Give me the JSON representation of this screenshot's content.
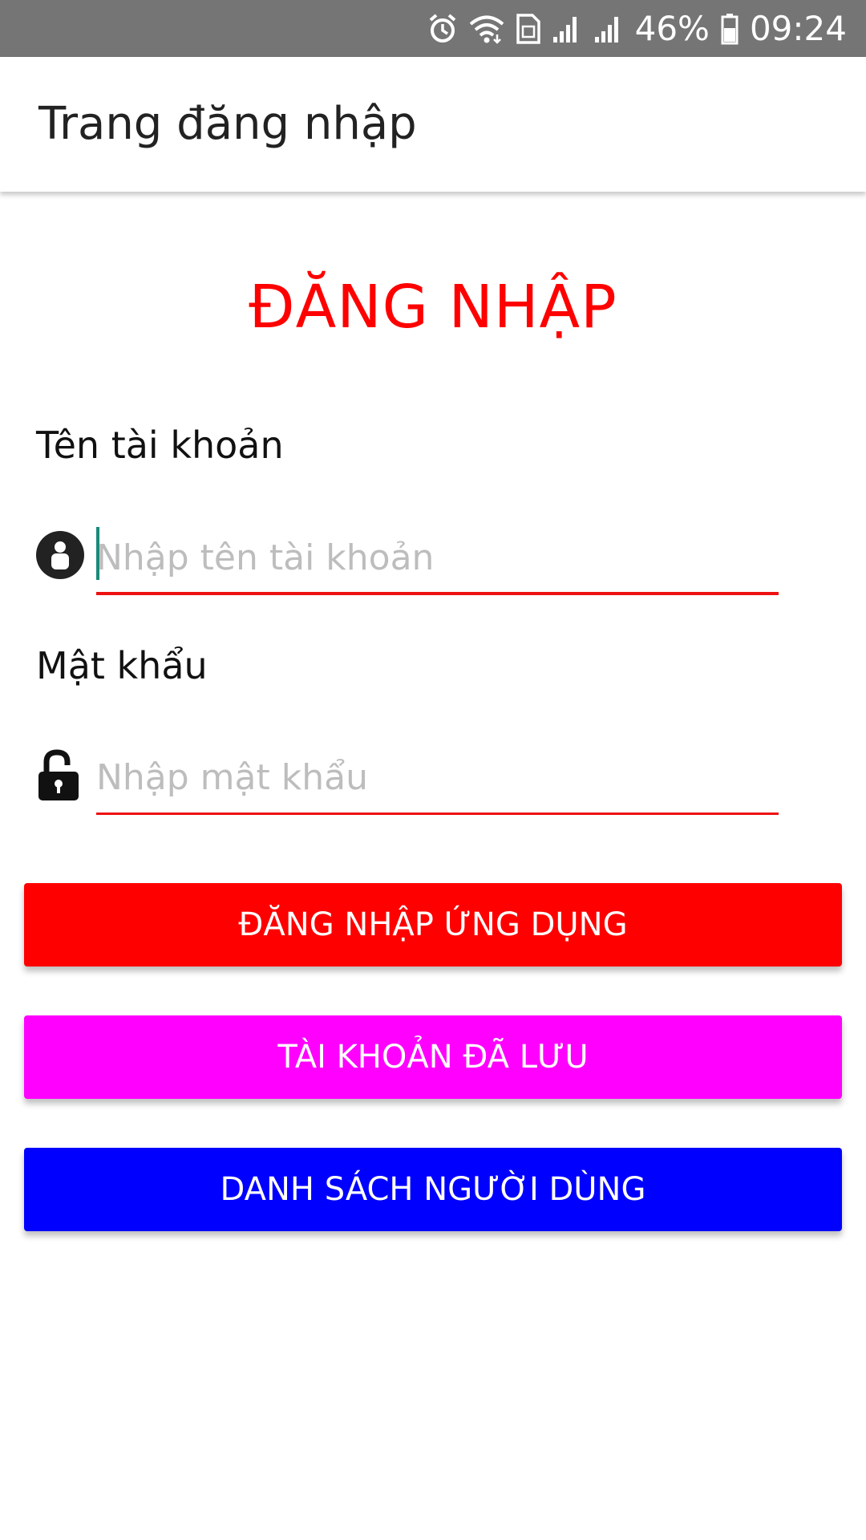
{
  "status_bar": {
    "battery": "46%",
    "time": "09:24",
    "icons": [
      "alarm-icon",
      "wifi-icon",
      "sim-icon",
      "signal-icon",
      "signal-icon",
      "battery-icon"
    ]
  },
  "app_bar": {
    "title": "Trang đăng nhập"
  },
  "heading": "ĐĂNG NHẬP",
  "username": {
    "label": "Tên tài khoản",
    "placeholder": "Nhập tên tài khoản",
    "value": "",
    "icon": "user-icon"
  },
  "password": {
    "label": "Mật khẩu",
    "placeholder": "Nhập mật khẩu",
    "value": "",
    "icon": "lock-open-icon"
  },
  "buttons": {
    "login": "ĐĂNG NHẬP ỨNG DỤNG",
    "saved_accounts": "TÀI KHOẢN ĐÃ LƯU",
    "user_list": "DANH SÁCH NGƯỜI DÙNG"
  },
  "colors": {
    "status_bar": "#757575",
    "heading": "#ff0000",
    "underline": "#ee1111",
    "login_button": "#ff0000",
    "saved_button": "#ff00ff",
    "users_button": "#0000ff"
  }
}
